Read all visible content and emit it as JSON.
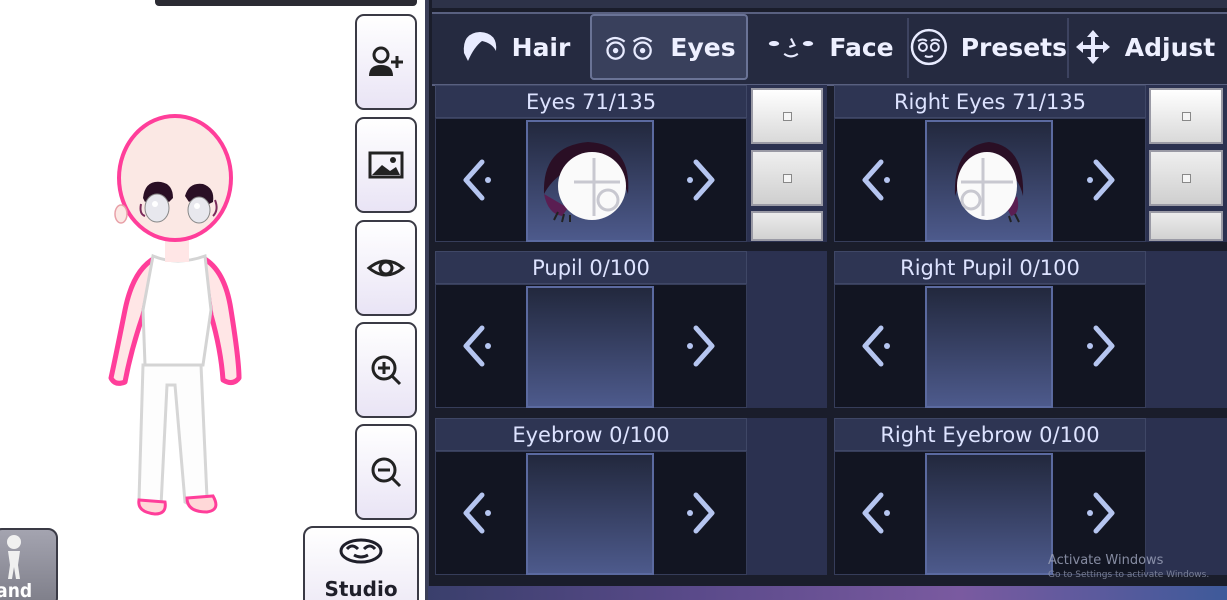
{
  "sidebar": {
    "buttons": [
      {
        "icon": "add-person-icon"
      },
      {
        "icon": "image-icon"
      },
      {
        "icon": "eye-icon"
      },
      {
        "icon": "zoom-in-icon"
      },
      {
        "icon": "zoom-out-icon"
      }
    ],
    "stand_label": "tand",
    "studio_label": "Studio"
  },
  "tabs": [
    {
      "label": "Hair",
      "icon": "hair-icon",
      "active": false
    },
    {
      "label": "Eyes",
      "icon": "eyes-icon",
      "active": true
    },
    {
      "label": "Face",
      "icon": "face-icon",
      "active": false
    },
    {
      "label": "Presets",
      "icon": "presets-icon",
      "active": false
    },
    {
      "label": "Adjust",
      "icon": "move-arrows-icon",
      "active": false
    }
  ],
  "panes": {
    "eyes": "Eyes 71/135",
    "right_eyes": "Right Eyes 71/135",
    "pupil": "Pupil 0/100",
    "right_pupil": "Right Pupil 0/100",
    "eyebrow": "Eyebrow 0/100",
    "right_eyebrow": "Right Eyebrow 0/100"
  },
  "watermark": {
    "line1": "Activate Windows",
    "line2": "Go to Settings to activate Windows."
  },
  "colors": {
    "panel_bg": "#1a1d2b",
    "tab_bg": "#252a40",
    "character_outline": "#ff3e9a",
    "eye_dark": "#2a0f25"
  }
}
